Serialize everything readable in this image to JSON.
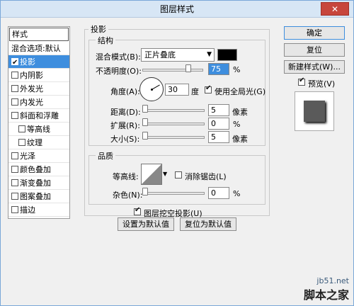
{
  "title": "图层样式",
  "close_label": "✕",
  "style_list": {
    "header": "样式",
    "items": [
      {
        "label": "混合选项:默认",
        "checkbox": false,
        "checked": false,
        "selected": false,
        "sub": false
      },
      {
        "label": "投影",
        "checkbox": true,
        "checked": true,
        "selected": true,
        "sub": false
      },
      {
        "label": "内阴影",
        "checkbox": true,
        "checked": false,
        "selected": false,
        "sub": false
      },
      {
        "label": "外发光",
        "checkbox": true,
        "checked": false,
        "selected": false,
        "sub": false
      },
      {
        "label": "内发光",
        "checkbox": true,
        "checked": false,
        "selected": false,
        "sub": false
      },
      {
        "label": "斜面和浮雕",
        "checkbox": true,
        "checked": false,
        "selected": false,
        "sub": false
      },
      {
        "label": "等高线",
        "checkbox": true,
        "checked": false,
        "selected": false,
        "sub": true
      },
      {
        "label": "纹理",
        "checkbox": true,
        "checked": false,
        "selected": false,
        "sub": true
      },
      {
        "label": "光泽",
        "checkbox": true,
        "checked": false,
        "selected": false,
        "sub": false
      },
      {
        "label": "颜色叠加",
        "checkbox": true,
        "checked": false,
        "selected": false,
        "sub": false
      },
      {
        "label": "渐变叠加",
        "checkbox": true,
        "checked": false,
        "selected": false,
        "sub": false
      },
      {
        "label": "图案叠加",
        "checkbox": true,
        "checked": false,
        "selected": false,
        "sub": false
      },
      {
        "label": "描边",
        "checkbox": true,
        "checked": false,
        "selected": false,
        "sub": false
      }
    ]
  },
  "shadow": {
    "title": "投影",
    "structure_title": "结构",
    "blend_mode_label": "混合模式(B):",
    "blend_mode_value": "正片叠底",
    "color": "#000000",
    "opacity_label": "不透明度(O):",
    "opacity_value": "75",
    "opacity_unit": "%",
    "opacity_fraction": 0.75,
    "angle_label": "角度(A):",
    "angle_value": "30",
    "angle_unit": "度",
    "global_light_label": "使用全局光(G)",
    "global_light_checked": true,
    "distance_label": "距离(D):",
    "distance_value": "5",
    "distance_unit": "像素",
    "spread_label": "扩展(R):",
    "spread_value": "0",
    "spread_unit": "%",
    "size_label": "大小(S):",
    "size_value": "5",
    "size_unit": "像素"
  },
  "quality": {
    "title": "品质",
    "contour_label": "等高线:",
    "anti_alias_label": "消除锯齿(L)",
    "anti_alias_checked": false,
    "noise_label": "杂色(N):",
    "noise_value": "0",
    "noise_unit": "%"
  },
  "knockout_label": "图层挖空投影(U)",
  "knockout_checked": true,
  "make_default_label": "设置为默认值",
  "reset_default_label": "复位为默认值",
  "buttons": {
    "ok": "确定",
    "reset": "复位",
    "new_style": "新建样式(W)...",
    "preview": "预览(V)",
    "preview_checked": true
  },
  "watermark": {
    "site": "jb51.net",
    "name": "脚本之家"
  },
  "colors": {
    "selection": "#3e8ede",
    "title_bar": "#d7e6f5",
    "close_button": "#c7463c"
  }
}
